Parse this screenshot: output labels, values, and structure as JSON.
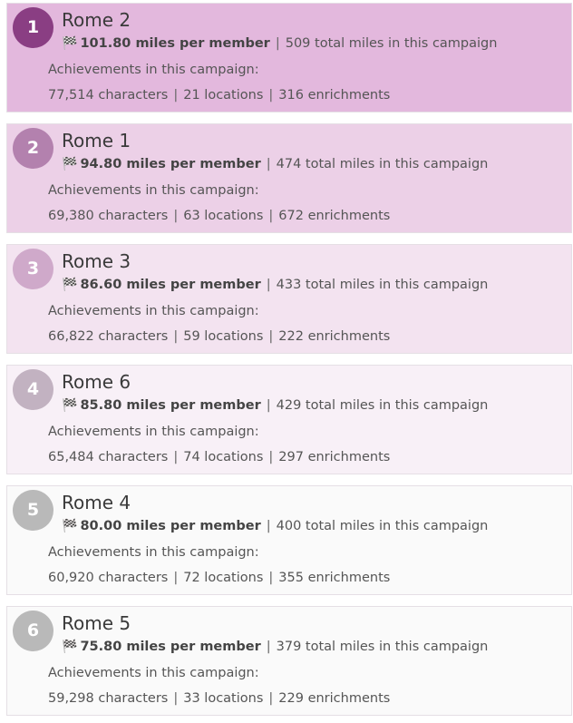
{
  "colors": {
    "card_backgrounds": [
      "#e3b8dd",
      "#ecd0e7",
      "#f3e3f0",
      "#f8f0f7",
      "#fafafa",
      "#fafafa"
    ],
    "badge_backgrounds": [
      "#8a3e83",
      "#b381ae",
      "#cfa9ca",
      "#c2b2c1",
      "#b9b9b9",
      "#b9b9b9"
    ]
  },
  "icons": {
    "flag": "checkered-flag-icon",
    "flag_glyph": "🏁"
  },
  "leaderboard": [
    {
      "rank": "1",
      "name": "Rome 2",
      "miles_per_member": "101.80 miles per member",
      "total_miles": "509 total miles in this campaign",
      "achievements_label": "Achievements in this campaign:",
      "characters": "77,514 characters",
      "locations": "21 locations",
      "enrichments": "316 enrichments"
    },
    {
      "rank": "2",
      "name": "Rome 1",
      "miles_per_member": "94.80 miles per member",
      "total_miles": "474 total miles in this campaign",
      "achievements_label": "Achievements in this campaign:",
      "characters": "69,380 characters",
      "locations": "63 locations",
      "enrichments": "672 enrichments"
    },
    {
      "rank": "3",
      "name": "Rome 3",
      "miles_per_member": "86.60 miles per member",
      "total_miles": "433 total miles in this campaign",
      "achievements_label": "Achievements in this campaign:",
      "characters": "66,822 characters",
      "locations": "59 locations",
      "enrichments": "222 enrichments"
    },
    {
      "rank": "4",
      "name": "Rome 6",
      "miles_per_member": "85.80 miles per member",
      "total_miles": "429 total miles in this campaign",
      "achievements_label": "Achievements in this campaign:",
      "characters": "65,484 characters",
      "locations": "74 locations",
      "enrichments": "297 enrichments"
    },
    {
      "rank": "5",
      "name": "Rome 4",
      "miles_per_member": "80.00 miles per member",
      "total_miles": "400 total miles in this campaign",
      "achievements_label": "Achievements in this campaign:",
      "characters": "60,920 characters",
      "locations": "72 locations",
      "enrichments": "355 enrichments"
    },
    {
      "rank": "6",
      "name": "Rome 5",
      "miles_per_member": "75.80 miles per member",
      "total_miles": "379 total miles in this campaign",
      "achievements_label": "Achievements in this campaign:",
      "characters": "59,298 characters",
      "locations": "33 locations",
      "enrichments": "229 enrichments"
    }
  ]
}
